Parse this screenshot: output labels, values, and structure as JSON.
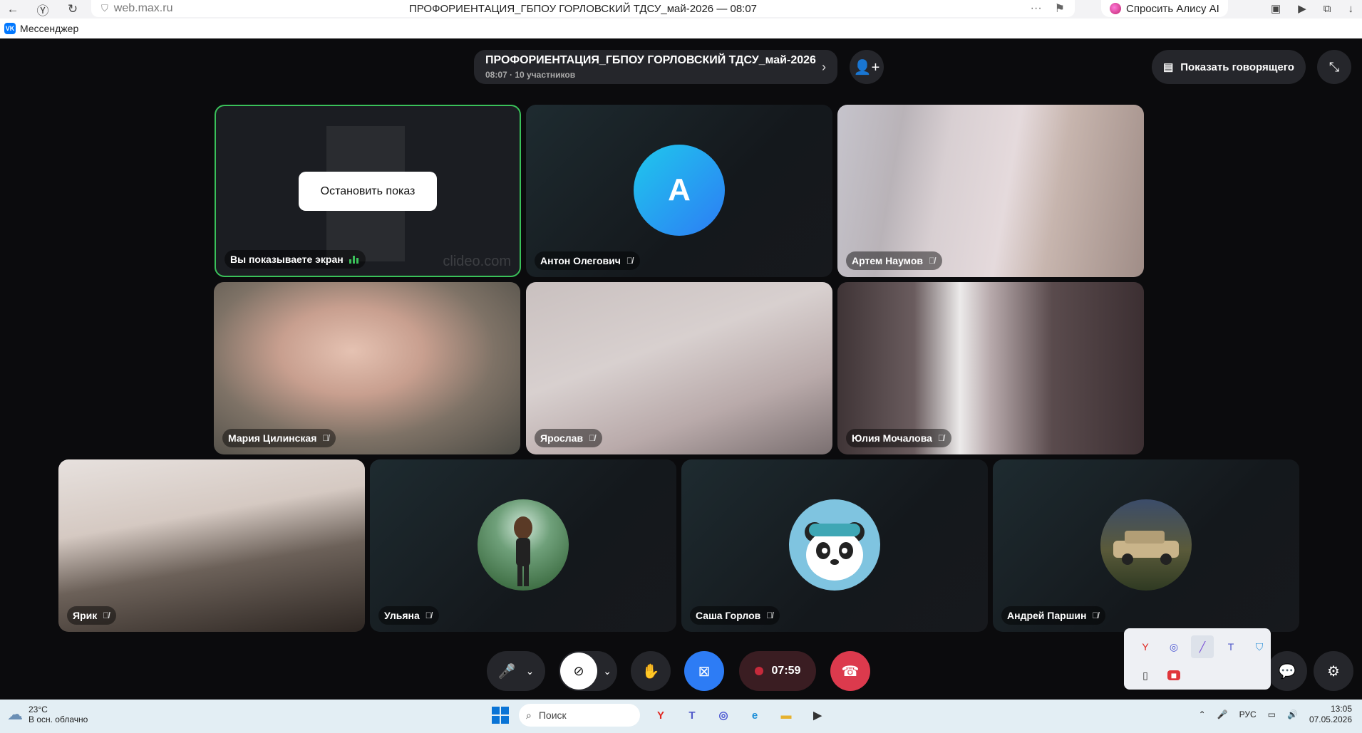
{
  "browser": {
    "url": "web.max.ru",
    "page_title": "ПРОФОРИЕНТАЦИЯ_ГБПОУ ГОРЛОВСКИЙ ТДСУ_май-2026 — 08:07",
    "alisa_label": "Спросить Алису AI",
    "more": "···"
  },
  "bookmarks": [
    {
      "label": "Мессенджер",
      "icon": "vk-icon"
    }
  ],
  "call": {
    "title": "ПРОФОРИЕНТАЦИЯ_ГБПОУ ГОРЛОВСКИЙ ТДСУ_май-2026",
    "subtitle": "08:07 · 10 участников",
    "show_speaker": "Показать говорящего"
  },
  "share_tile": {
    "name": "Вы показываете экран",
    "stop_label": "Остановить показ",
    "watermark": "clideo.com"
  },
  "participants": [
    {
      "name": "Антон Олегович",
      "avatar_letter": "А",
      "kind": "letter"
    },
    {
      "name": "Артем Наумов",
      "kind": "camera"
    },
    {
      "name": "Мария Цилинская",
      "kind": "camera"
    },
    {
      "name": "Ярослав",
      "kind": "camera"
    },
    {
      "name": "Юлия Мочалова",
      "kind": "camera"
    },
    {
      "name": "Ярик",
      "kind": "camera"
    },
    {
      "name": "Ульяна",
      "kind": "photo"
    },
    {
      "name": "Саша Горлов",
      "kind": "photo"
    },
    {
      "name": "Андрей Паршин",
      "kind": "photo"
    }
  ],
  "controls": {
    "timer": "07:59"
  },
  "taskbar": {
    "temp": "23°C",
    "weather": "В осн. облачно",
    "search": "Поиск",
    "lang": "РУС",
    "time": "13:05",
    "date": "07.05.2026"
  },
  "colors": {
    "share_border": "#3ac15a",
    "hangup": "#dc3a4d",
    "accent_blue": "#2d7cf5"
  }
}
